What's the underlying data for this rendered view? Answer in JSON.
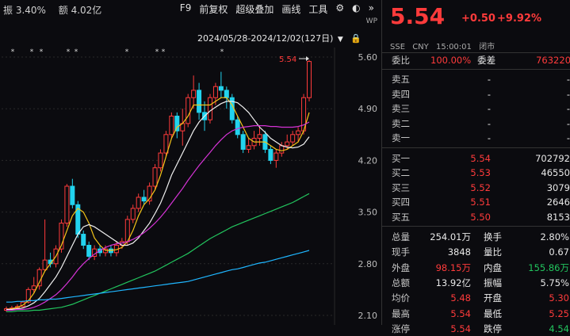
{
  "toolbar": {
    "amplitude": "振 3.40%",
    "turnover": "额 4.02亿",
    "items": [
      "F9",
      "前复权",
      "超级叠加",
      "画线",
      "工具"
    ]
  },
  "chart": {
    "date_range": "2024/05/28-2024/12/02(127日)",
    "y_ticks": [
      "5.60",
      "4.90",
      "4.20",
      "3.50",
      "2.80",
      "2.10"
    ],
    "last_label": "5.54"
  },
  "chart_data": {
    "type": "candlestick",
    "ylim": [
      2.1,
      5.6
    ],
    "candles": [
      [
        2.17,
        2.19,
        2.15,
        2.22
      ],
      [
        2.19,
        2.2,
        2.17,
        2.23
      ],
      [
        2.2,
        2.22,
        2.18,
        2.25
      ],
      [
        2.22,
        2.28,
        2.2,
        2.3
      ],
      [
        2.28,
        2.45,
        2.26,
        2.48
      ],
      [
        2.45,
        2.5,
        2.4,
        2.62
      ],
      [
        2.5,
        2.72,
        2.45,
        2.75
      ],
      [
        2.72,
        2.85,
        2.7,
        3.4
      ],
      [
        2.85,
        2.8,
        2.75,
        2.95
      ],
      [
        2.8,
        3.0,
        2.75,
        3.05
      ],
      [
        3.0,
        3.35,
        2.95,
        3.4
      ],
      [
        3.35,
        3.85,
        3.3,
        3.88
      ],
      [
        3.85,
        3.6,
        3.55,
        3.95
      ],
      [
        3.6,
        3.2,
        3.15,
        3.65
      ],
      [
        3.2,
        3.05,
        3.0,
        3.25
      ],
      [
        3.05,
        2.9,
        2.85,
        3.1
      ],
      [
        2.9,
        3.0,
        2.85,
        3.05
      ],
      [
        3.0,
        2.95,
        2.9,
        3.05
      ],
      [
        2.95,
        3.0,
        2.9,
        3.05
      ],
      [
        3.0,
        2.95,
        2.9,
        3.05
      ],
      [
        2.95,
        3.05,
        2.9,
        3.1
      ],
      [
        3.05,
        3.1,
        3.0,
        3.15
      ],
      [
        3.1,
        3.4,
        3.05,
        3.45
      ],
      [
        3.4,
        3.55,
        3.35,
        3.6
      ],
      [
        3.55,
        3.7,
        3.5,
        3.75
      ],
      [
        3.7,
        3.65,
        3.6,
        3.8
      ],
      [
        3.65,
        3.85,
        3.6,
        3.9
      ],
      [
        3.85,
        4.1,
        3.8,
        4.15
      ],
      [
        4.1,
        4.3,
        4.05,
        4.35
      ],
      [
        4.3,
        4.55,
        4.25,
        4.6
      ],
      [
        4.55,
        4.8,
        4.5,
        4.85
      ],
      [
        4.8,
        4.6,
        4.5,
        4.85
      ],
      [
        4.6,
        4.7,
        4.4,
        4.9
      ],
      [
        4.7,
        5.05,
        4.65,
        5.1
      ],
      [
        5.05,
        5.15,
        4.9,
        5.35
      ],
      [
        5.15,
        4.85,
        4.75,
        5.25
      ],
      [
        4.85,
        4.75,
        4.6,
        5.0
      ],
      [
        4.75,
        5.05,
        4.7,
        5.1
      ],
      [
        5.05,
        5.2,
        4.95,
        5.25
      ],
      [
        5.2,
        5.15,
        5.05,
        5.4
      ],
      [
        5.15,
        5.05,
        4.9,
        5.2
      ],
      [
        5.05,
        4.75,
        4.7,
        5.1
      ],
      [
        4.75,
        4.55,
        4.5,
        4.8
      ],
      [
        4.55,
        4.35,
        4.3,
        4.6
      ],
      [
        4.35,
        4.4,
        4.3,
        4.5
      ],
      [
        4.4,
        4.5,
        4.35,
        4.6
      ],
      [
        4.5,
        4.55,
        4.4,
        4.65
      ],
      [
        4.55,
        4.35,
        4.3,
        4.6
      ],
      [
        4.35,
        4.2,
        4.15,
        4.4
      ],
      [
        4.2,
        4.3,
        4.1,
        4.35
      ],
      [
        4.3,
        4.4,
        4.25,
        4.45
      ],
      [
        4.4,
        4.45,
        4.35,
        4.55
      ],
      [
        4.45,
        4.55,
        4.4,
        4.6
      ],
      [
        4.55,
        4.6,
        4.45,
        4.65
      ],
      [
        4.6,
        5.05,
        4.55,
        5.1
      ],
      [
        5.05,
        5.54,
        5.0,
        5.56
      ]
    ],
    "ma": [
      {
        "name": "ma5",
        "color": "#f5c518",
        "values": [
          2.18,
          2.19,
          2.21,
          2.24,
          2.3,
          2.4,
          2.55,
          2.7,
          2.8,
          2.9,
          3.05,
          3.25,
          3.45,
          3.55,
          3.5,
          3.35,
          3.15,
          3.05,
          2.98,
          2.98,
          2.99,
          3.02,
          3.1,
          3.25,
          3.45,
          3.6,
          3.68,
          3.8,
          4.0,
          4.25,
          4.5,
          4.65,
          4.7,
          4.8,
          4.95,
          4.95,
          4.95,
          4.95,
          5.0,
          5.05,
          5.05,
          4.95,
          4.8,
          4.65,
          4.5,
          4.45,
          4.45,
          4.45,
          4.4,
          4.35,
          4.33,
          4.35,
          4.4,
          4.45,
          4.6,
          4.85
        ]
      },
      {
        "name": "ma10",
        "color": "#f0f0f0",
        "values": [
          2.18,
          2.18,
          2.19,
          2.2,
          2.23,
          2.27,
          2.33,
          2.42,
          2.52,
          2.62,
          2.75,
          2.9,
          3.05,
          3.2,
          3.3,
          3.33,
          3.3,
          3.25,
          3.2,
          3.15,
          3.1,
          3.05,
          3.05,
          3.08,
          3.15,
          3.25,
          3.35,
          3.48,
          3.62,
          3.8,
          4.0,
          4.15,
          4.3,
          4.45,
          4.6,
          4.72,
          4.8,
          4.87,
          4.92,
          4.97,
          5.0,
          5.0,
          4.98,
          4.92,
          4.85,
          4.75,
          4.65,
          4.58,
          4.5,
          4.45,
          4.4,
          4.38,
          4.37,
          4.38,
          4.42,
          4.52
        ]
      },
      {
        "name": "ma20",
        "color": "#d633d6",
        "values": [
          2.17,
          2.17,
          2.18,
          2.18,
          2.19,
          2.21,
          2.24,
          2.28,
          2.33,
          2.38,
          2.45,
          2.53,
          2.62,
          2.72,
          2.8,
          2.87,
          2.93,
          2.98,
          3.02,
          3.05,
          3.07,
          3.08,
          3.1,
          3.13,
          3.17,
          3.22,
          3.28,
          3.35,
          3.43,
          3.52,
          3.62,
          3.72,
          3.82,
          3.93,
          4.03,
          4.13,
          4.22,
          4.31,
          4.4,
          4.48,
          4.55,
          4.6,
          4.63,
          4.65,
          4.66,
          4.67,
          4.67,
          4.67,
          4.66,
          4.66,
          4.65,
          4.65,
          4.65,
          4.66,
          4.68,
          4.72
        ]
      },
      {
        "name": "ma60",
        "color": "#22c55e",
        "values": [
          2.15,
          2.15,
          2.16,
          2.16,
          2.16,
          2.17,
          2.17,
          2.18,
          2.19,
          2.2,
          2.21,
          2.23,
          2.25,
          2.28,
          2.31,
          2.34,
          2.37,
          2.4,
          2.43,
          2.46,
          2.49,
          2.52,
          2.55,
          2.58,
          2.61,
          2.64,
          2.67,
          2.7,
          2.74,
          2.78,
          2.82,
          2.86,
          2.9,
          2.94,
          2.99,
          3.04,
          3.09,
          3.14,
          3.18,
          3.22,
          3.26,
          3.3,
          3.33,
          3.36,
          3.39,
          3.42,
          3.45,
          3.48,
          3.51,
          3.54,
          3.57,
          3.6,
          3.63,
          3.67,
          3.71,
          3.75
        ]
      },
      {
        "name": "ma120",
        "color": "#1fb6ff",
        "values": [
          2.28,
          2.28,
          2.29,
          2.29,
          2.3,
          2.3,
          2.31,
          2.31,
          2.32,
          2.32,
          2.33,
          2.34,
          2.35,
          2.36,
          2.37,
          2.38,
          2.39,
          2.4,
          2.41,
          2.42,
          2.43,
          2.44,
          2.45,
          2.46,
          2.47,
          2.48,
          2.49,
          2.5,
          2.51,
          2.52,
          2.53,
          2.54,
          2.55,
          2.56,
          2.58,
          2.6,
          2.62,
          2.64,
          2.66,
          2.68,
          2.7,
          2.72,
          2.73,
          2.75,
          2.77,
          2.79,
          2.81,
          2.82,
          2.84,
          2.86,
          2.88,
          2.9,
          2.92,
          2.94,
          2.96,
          2.98
        ]
      }
    ]
  },
  "quote": {
    "price": "5.54",
    "change": "+0.50",
    "change_pct": "+9.92%",
    "exchange": "SSE",
    "currency": "CNY",
    "time": "15:00:01",
    "status": "闭市",
    "weibi_label": "委比",
    "weibi_value": "100.00%",
    "weicha_label": "委差",
    "weicha_value": "763220",
    "sells": [
      {
        "label": "卖五",
        "price": "-",
        "vol": "-"
      },
      {
        "label": "卖四",
        "price": "-",
        "vol": "-"
      },
      {
        "label": "卖三",
        "price": "-",
        "vol": "-"
      },
      {
        "label": "卖二",
        "price": "-",
        "vol": "-"
      },
      {
        "label": "卖一",
        "price": "-",
        "vol": "-"
      }
    ],
    "buys": [
      {
        "label": "买一",
        "price": "5.54",
        "vol": "702792"
      },
      {
        "label": "买二",
        "price": "5.53",
        "vol": "46550"
      },
      {
        "label": "买三",
        "price": "5.52",
        "vol": "3079"
      },
      {
        "label": "买四",
        "price": "5.51",
        "vol": "2646"
      },
      {
        "label": "买五",
        "price": "5.50",
        "vol": "8153"
      }
    ],
    "stats": [
      {
        "l1": "总量",
        "v1": "254.01万",
        "l2": "换手",
        "v2": "2.80%",
        "c1": "white",
        "c2": "white"
      },
      {
        "l1": "现手",
        "v1": "3848",
        "l2": "量比",
        "v2": "0.67",
        "c1": "white",
        "c2": "white"
      },
      {
        "l1": "外盘",
        "v1": "98.15万",
        "l2": "内盘",
        "v2": "155.86万",
        "c1": "red",
        "c2": "green"
      },
      {
        "l1": "总额",
        "v1": "13.92亿",
        "l2": "振幅",
        "v2": "5.75%",
        "c1": "white",
        "c2": "white"
      },
      {
        "l1": "均价",
        "v1": "5.48",
        "l2": "开盘",
        "v2": "5.30",
        "c1": "red",
        "c2": "red"
      },
      {
        "l1": "最高",
        "v1": "5.54",
        "l2": "最低",
        "v2": "5.25",
        "c1": "red",
        "c2": "red"
      },
      {
        "l1": "涨停",
        "v1": "5.54",
        "l2": "跌停",
        "v2": "4.54",
        "c1": "red",
        "c2": "green"
      }
    ]
  }
}
